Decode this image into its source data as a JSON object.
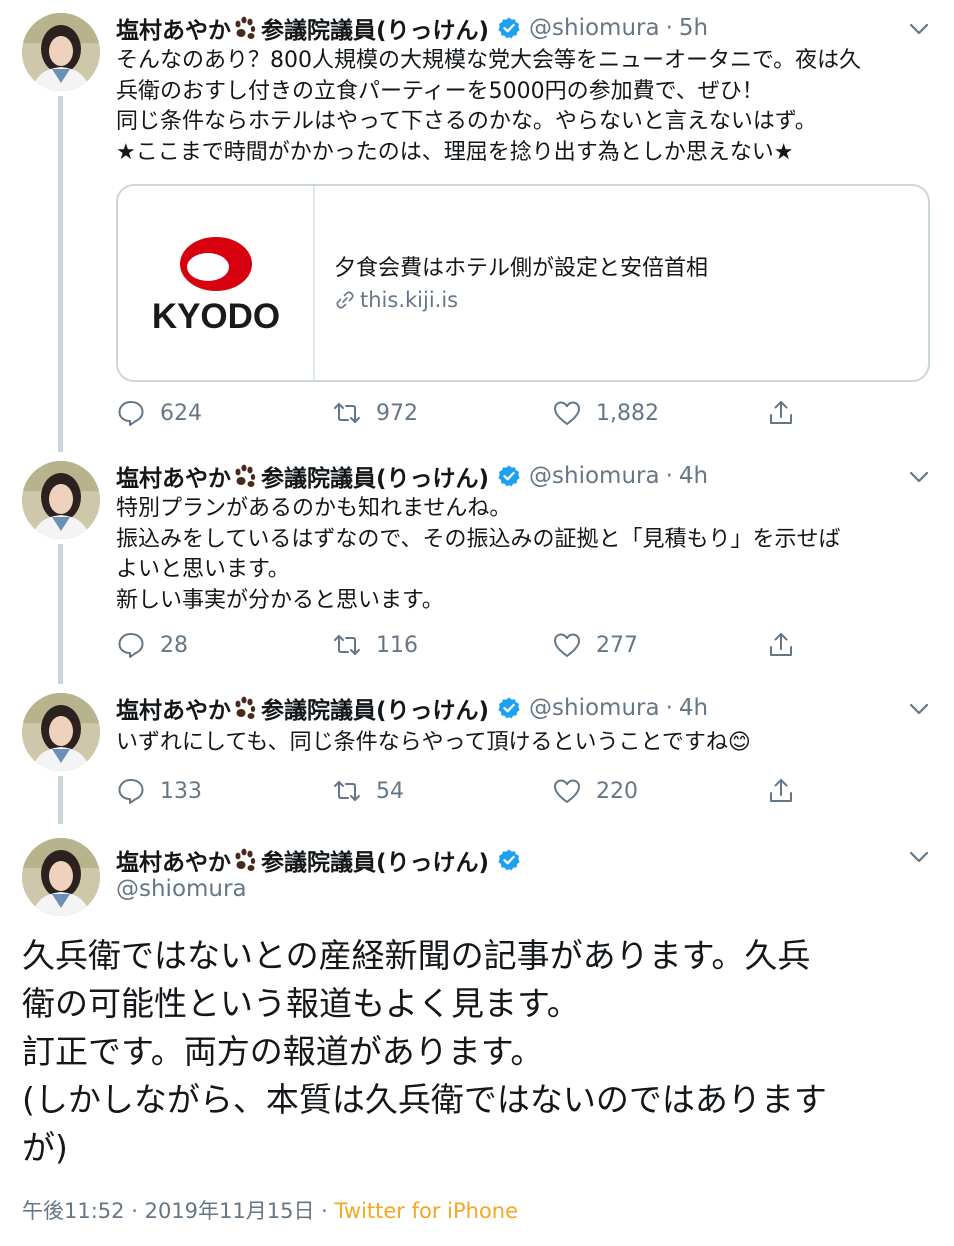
{
  "colors": {
    "link_color": "#f5a623",
    "verified_blue": "#1da1f2",
    "text_secondary": "#657786",
    "thread_line": "#ccd6dd",
    "kyodo_red": "#d7000f"
  },
  "icons": {
    "paw": "paw-icon",
    "verified": "verified-badge-icon",
    "caret": "chevron-down-icon",
    "reply": "reply-icon",
    "retweet": "retweet-icon",
    "like": "heart-icon",
    "share": "share-icon",
    "link": "link-icon"
  },
  "tweets": [
    {
      "name_part1": "塩村あやか",
      "name_part2": "参議院議員(りっけん)",
      "handle": "@shiomura",
      "separator": "·",
      "time": "5h",
      "lines": [
        "そんなのあり？800人規模の大規模な党大会等をニューオータニで。夜は久",
        "兵衛のおすし付きの立食パーティーを5000円の参加費で、ぜひ！",
        "同じ条件ならホテルはやって下さるのかな。やらないと言えないはず。",
        "★ここまで時間がかかったのは、理屈を捻り出す為としか思えない★"
      ],
      "card": {
        "logo_text": "KYODO",
        "title": "夕食会費はホテル側が設定と安倍首相",
        "domain": "this.kiji.is"
      },
      "replies": "624",
      "retweets": "972",
      "likes": "1,882"
    },
    {
      "name_part1": "塩村あやか",
      "name_part2": "参議院議員(りっけん)",
      "handle": "@shiomura",
      "separator": "·",
      "time": "4h",
      "lines": [
        "特別プランがあるのかも知れませんね。",
        "振込みをしているはずなので、その振込みの証拠と「見積もり」を示せば",
        "よいと思います。",
        "新しい事実が分かると思います。"
      ],
      "replies": "28",
      "retweets": "116",
      "likes": "277"
    },
    {
      "name_part1": "塩村あやか",
      "name_part2": "参議院議員(りっけん)",
      "handle": "@shiomura",
      "separator": "·",
      "time": "4h",
      "lines": [
        "いずれにしても、同じ条件ならやって頂けるということですね"
      ],
      "emoji": "😊",
      "replies": "133",
      "retweets": "54",
      "likes": "220"
    }
  ],
  "main_tweet": {
    "name_part1": "塩村あやか",
    "name_part2": "参議院議員(りっけん)",
    "handle": "@shiomura",
    "lines": [
      "久兵衛ではないとの産経新聞の記事があります。久兵",
      "衛の可能性という報道もよく見ます。",
      "訂正です。両方の報道があります。",
      "(しかしながら、本質は久兵衛ではないのではあります",
      "が)"
    ],
    "time": "午後11:52",
    "sep": "·",
    "date": "2019年11月15日",
    "sep2": "·",
    "source": "Twitter for iPhone"
  }
}
